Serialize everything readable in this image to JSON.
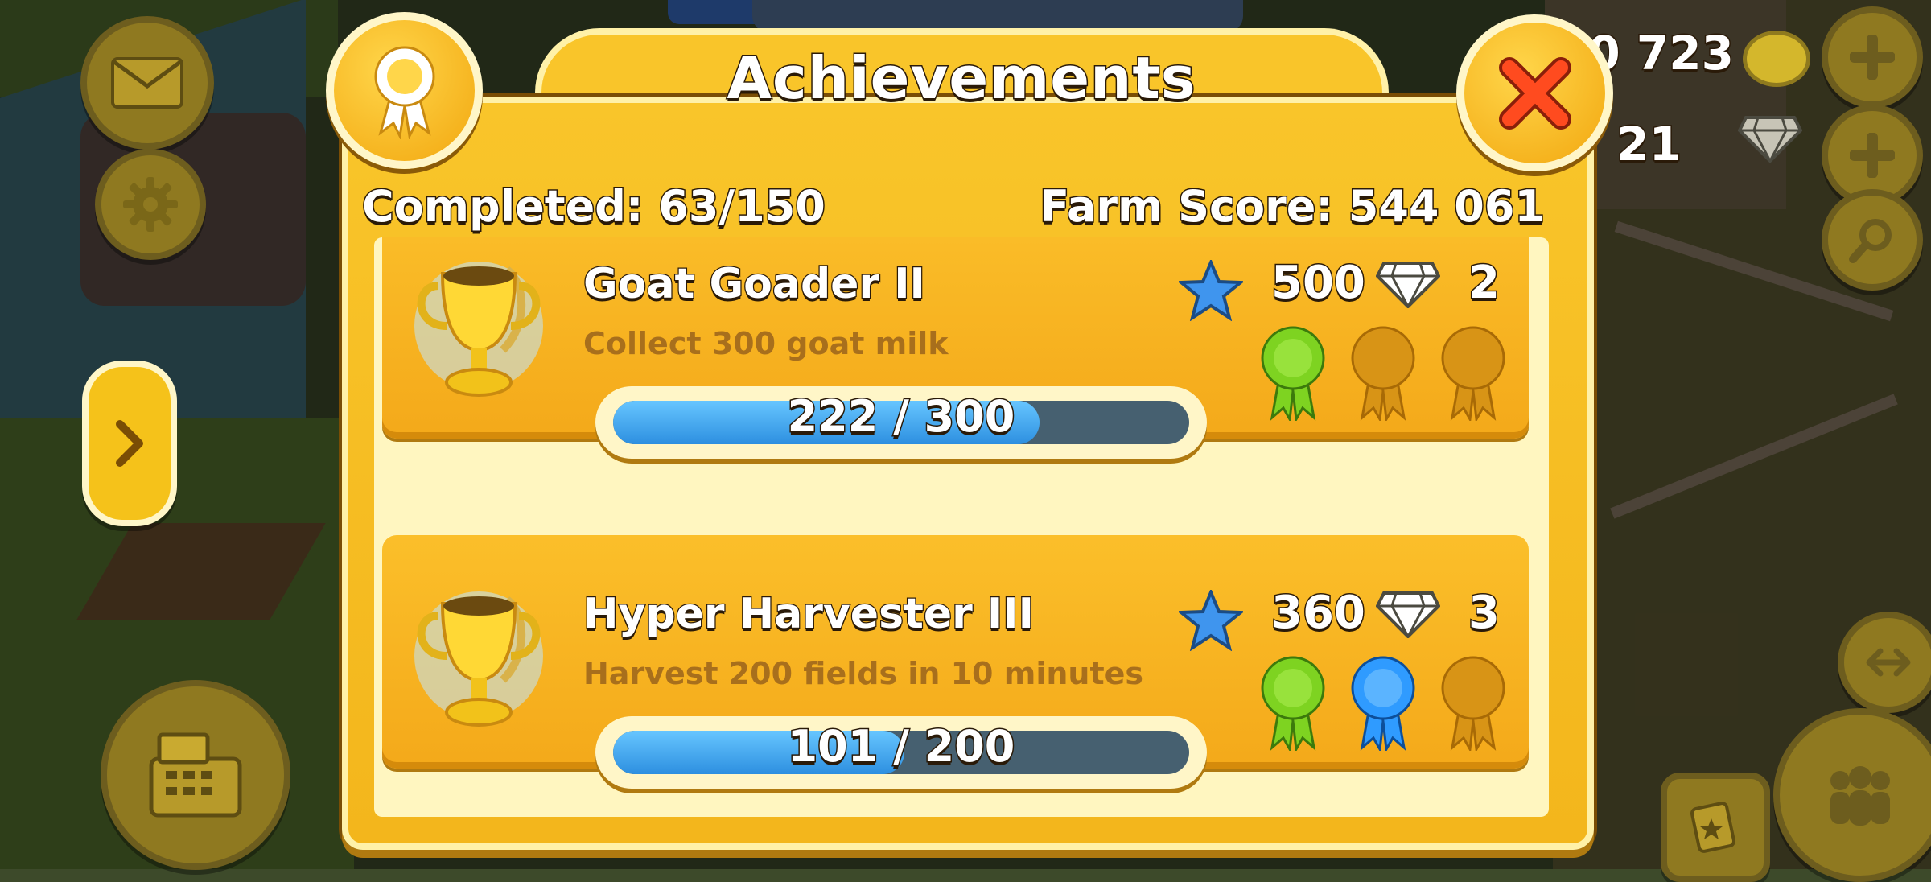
{
  "hud": {
    "coins": "020 723",
    "diamonds": "21"
  },
  "panel": {
    "title": "Achievements",
    "completed": "Completed: 63/150",
    "farm_score": "Farm Score: 544 061"
  },
  "achievements": [
    {
      "name": "Goat Goader II",
      "description": "Collect 300 goat milk",
      "xp_reward": "500",
      "diamond_reward": "2",
      "progress_label": "222 / 300",
      "progress_fraction": 0.74,
      "ribbons": [
        "green",
        "empty",
        "empty"
      ]
    },
    {
      "name": "Hyper Harvester III",
      "description": "Harvest 200 fields in 10 minutes",
      "xp_reward": "360",
      "diamond_reward": "3",
      "progress_label": "101 / 200",
      "progress_fraction": 0.505,
      "ribbons": [
        "green",
        "blue",
        "empty"
      ]
    }
  ],
  "colors": {
    "panel": "#f9c52a",
    "ribbon_green": "#7ed321",
    "ribbon_blue": "#2f9bff",
    "ribbon_empty": "#c98a10",
    "close_x": "#ff4b1f"
  },
  "icons": {
    "mail": "mail-icon",
    "settings": "gear-icon",
    "shop": "cash-register-icon",
    "badge": "rosette-icon",
    "close": "close-icon",
    "xp": "star-icon",
    "gems": "diamond-icon",
    "search": "magnifier-icon",
    "friends": "friends-icon"
  }
}
